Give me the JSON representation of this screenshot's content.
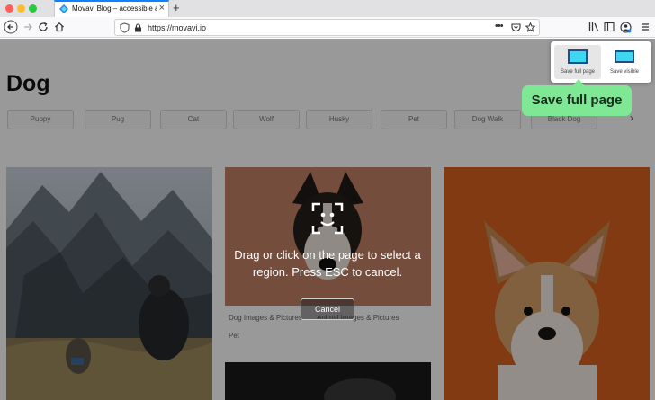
{
  "browser": {
    "tab_title": "Movavi Blog – accessible artic...",
    "tab_close": "×",
    "new_tab": "+",
    "url": "https://movavi.io",
    "icons": {
      "back": "arrow-left-icon",
      "forward": "arrow-right-icon",
      "reload": "reload-icon",
      "home": "home-icon",
      "shield": "tracking-shield-icon",
      "lock": "lock-icon",
      "more": "more-dots-icon",
      "pocket": "pocket-icon",
      "bookmark": "star-icon",
      "library": "library-icon",
      "sidebar": "sidebar-icon",
      "account": "account-icon",
      "menu": "hamburger-menu-icon"
    }
  },
  "page": {
    "title": "Dog",
    "chips": [
      "Puppy",
      "Pug",
      "Cat",
      "Wolf",
      "Husky",
      "Pet",
      "Dog Walk",
      "Black Dog"
    ],
    "chips_next": "›",
    "cards": [
      {
        "captions": []
      },
      {
        "captions": [
          "Dog Images & Pictures",
          "Animal Images & Pictures",
          "Pet"
        ]
      },
      {
        "captions": []
      }
    ]
  },
  "overlay": {
    "hint": "Drag or click on the page to select a region. Press ESC to cancel.",
    "cancel": "Cancel"
  },
  "screenshot_panel": {
    "save_full": "Save full page",
    "save_visible": "Save visible",
    "tooltip": "Save full page"
  },
  "colors": {
    "accent_tab": "#0a84ff",
    "tooltip": "#7ee895",
    "save_icon": "#3fd6f1"
  }
}
